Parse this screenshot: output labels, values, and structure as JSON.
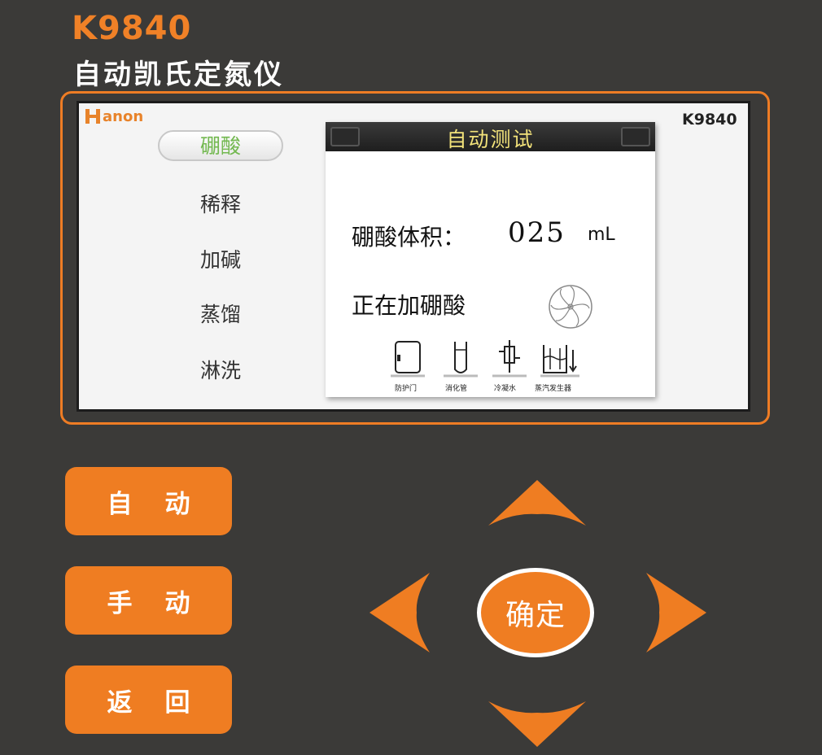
{
  "header": {
    "model": "K9840",
    "subtitle": "自动凯氏定氮仪"
  },
  "screen": {
    "brand": "anon",
    "model": "K9840",
    "steps": [
      {
        "label": "硼酸",
        "active": true
      },
      {
        "label": "稀释",
        "active": false
      },
      {
        "label": "加碱",
        "active": false
      },
      {
        "label": "蒸馏",
        "active": false
      },
      {
        "label": "淋洗",
        "active": false
      }
    ],
    "dialog": {
      "title": "自动测试",
      "volume_label": "硼酸体积：",
      "volume_value": "025",
      "volume_unit": "mL",
      "status": "正在加硼酸",
      "devices": [
        "防护门",
        "消化管",
        "冷凝水",
        "蒸汽发生器"
      ]
    }
  },
  "buttons": {
    "auto": "自动",
    "manual": "手动",
    "back": "返回",
    "confirm": "确定"
  },
  "colors": {
    "accent": "#ef7d22",
    "panel": "#3b3a38",
    "active_step": "#72b84f",
    "dialog_title": "#f2e27a"
  },
  "icons": [
    "up-arrow-icon",
    "down-arrow-icon",
    "left-arrow-icon",
    "right-arrow-icon",
    "fan-icon",
    "door-icon",
    "tube-icon",
    "condenser-icon",
    "steam-generator-icon"
  ]
}
